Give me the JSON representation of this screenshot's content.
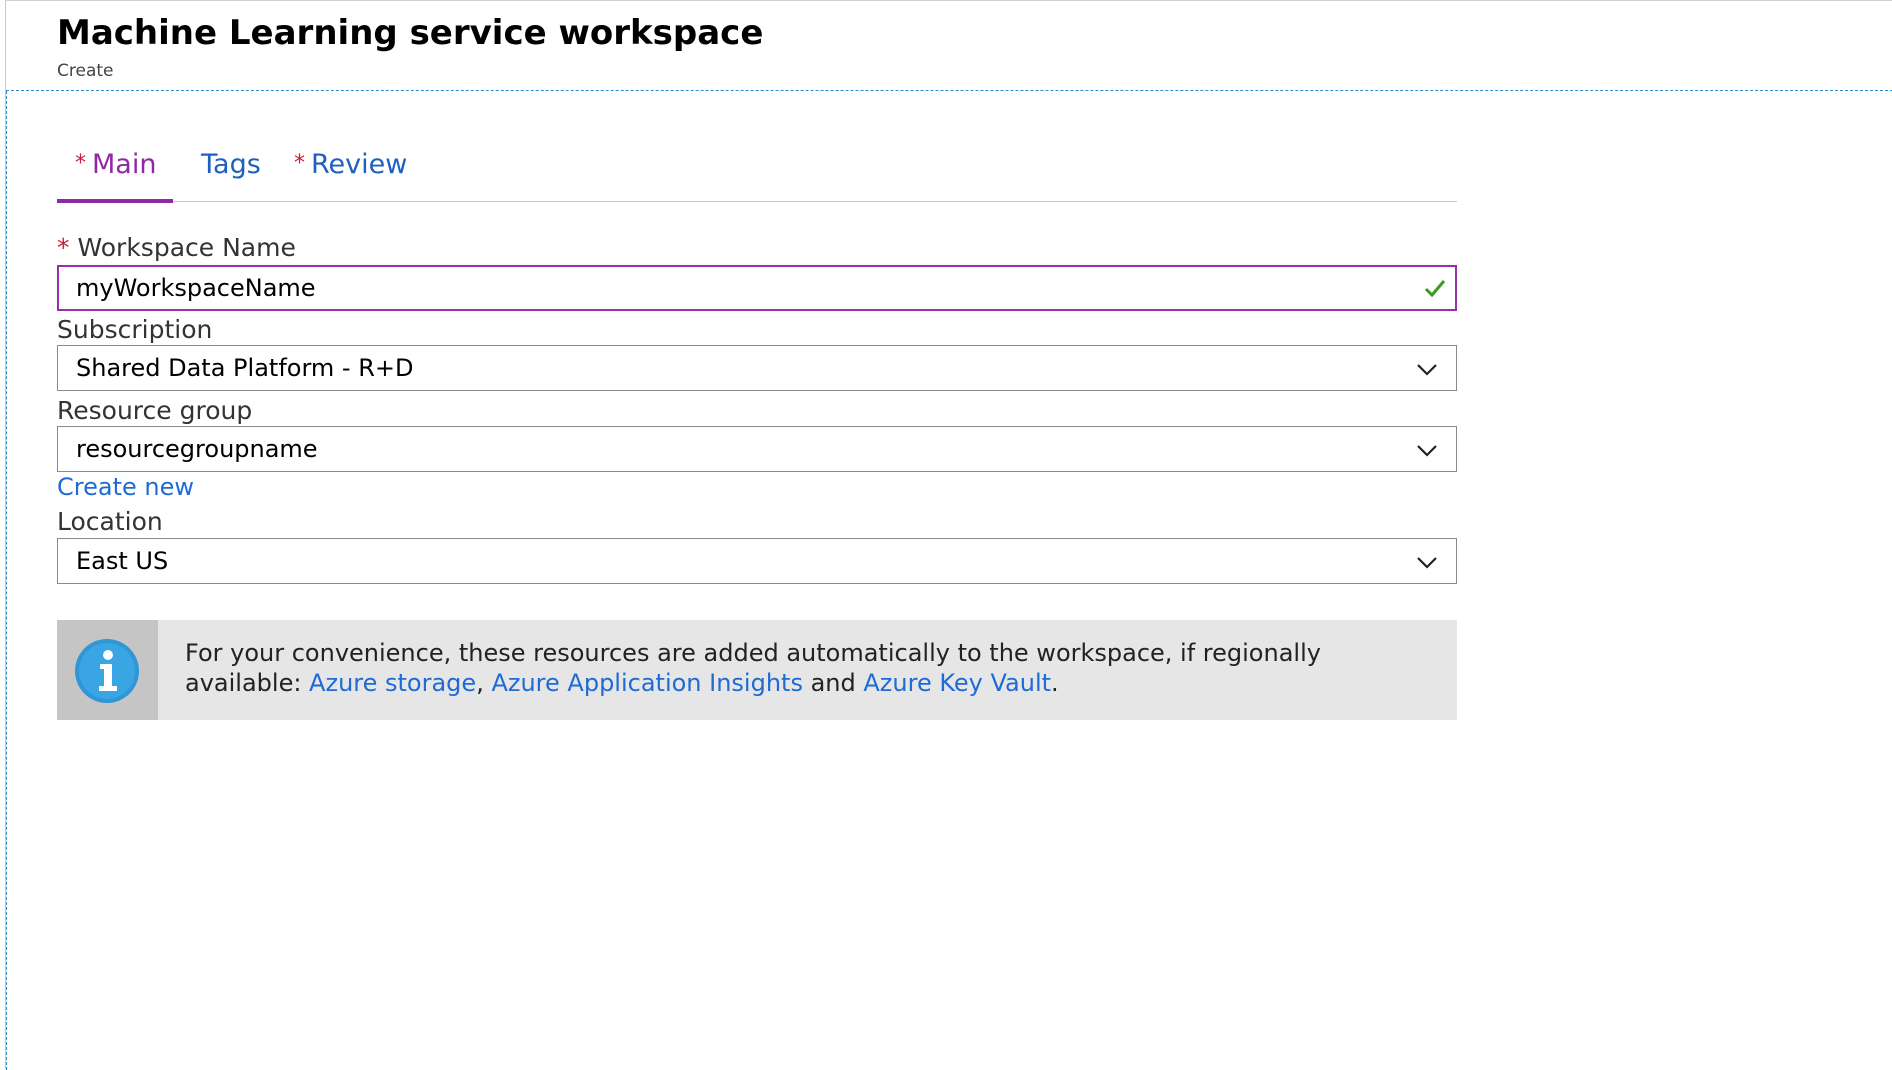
{
  "header": {
    "title": "Machine Learning service workspace",
    "subtitle": "Create"
  },
  "tabs": [
    {
      "label": "Main",
      "required": "*",
      "active": true
    },
    {
      "label": "Tags",
      "required": "",
      "active": false
    },
    {
      "label": "Review",
      "required": "*",
      "active": false
    }
  ],
  "form": {
    "workspace_name": {
      "required": "*",
      "label": "Workspace Name",
      "value": "myWorkspaceName"
    },
    "subscription": {
      "label": "Subscription",
      "value": "Shared Data Platform - R+D"
    },
    "resource_group": {
      "label": "Resource group",
      "value": "resourcegroupname",
      "create_new": "Create new"
    },
    "location": {
      "label": "Location",
      "value": "East US"
    }
  },
  "info": {
    "text_before": "For your convenience, these resources are added automatically to the workspace, if regionally available: ",
    "link_storage": "Azure storage",
    "sep1": ", ",
    "link_insights": "Azure Application Insights",
    "sep2": " and ",
    "link_keyvault": "Azure Key Vault",
    "end": "."
  },
  "colors": {
    "accent": "#8f2aa4",
    "link": "#1e6bd6",
    "required": "#d01b3a",
    "valid": "#3c9b1f"
  }
}
